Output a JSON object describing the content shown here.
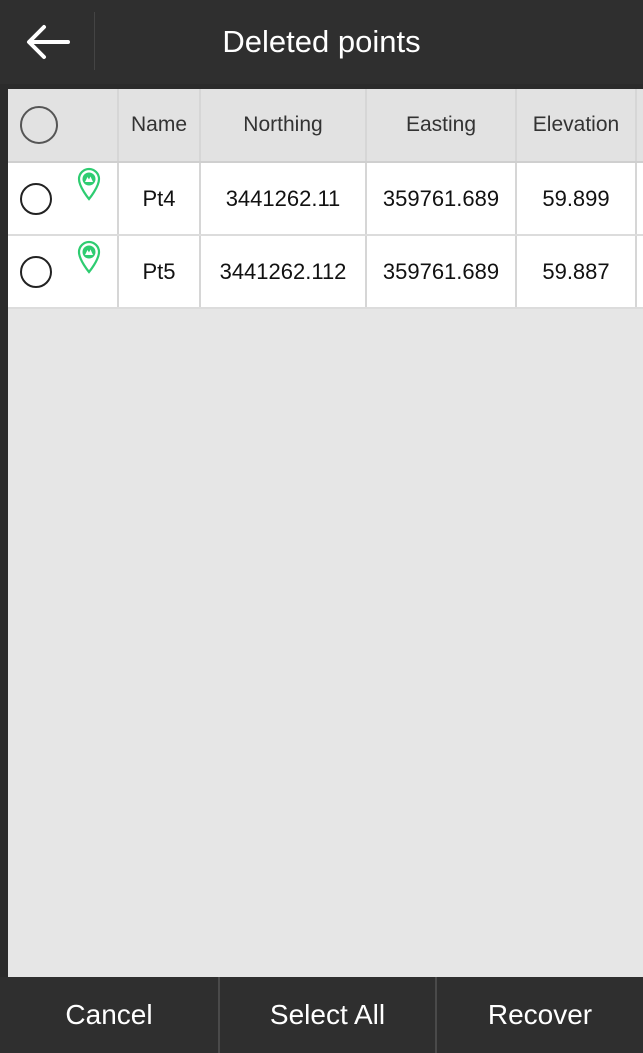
{
  "header": {
    "title": "Deleted points",
    "back_icon": "arrow-left-icon"
  },
  "table": {
    "columns": [
      "Name",
      "Northing",
      "Easting",
      "Elevation"
    ],
    "rows": [
      {
        "name": "Pt4",
        "northing": "3441262.11",
        "easting": "359761.689",
        "elevation": "59.899",
        "selected": false,
        "icon": "map-pin-icon"
      },
      {
        "name": "Pt5",
        "northing": "3441262.112",
        "easting": "359761.689",
        "elevation": "59.887",
        "selected": false,
        "icon": "map-pin-icon"
      }
    ]
  },
  "bottom": {
    "cancel_label": "Cancel",
    "select_all_label": "Select All",
    "recover_label": "Recover"
  },
  "colors": {
    "header_bg": "#2f2f2f",
    "content_bg": "#e6e6e6",
    "pin_green": "#2ecc71"
  }
}
